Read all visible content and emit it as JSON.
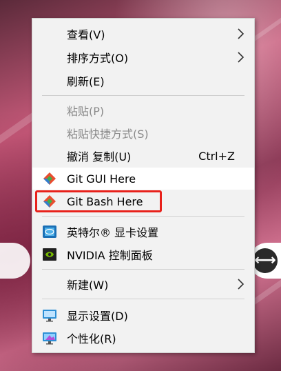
{
  "desktop": {
    "right_icon_glyph": "⟷"
  },
  "menu": {
    "items": [
      {
        "id": "view",
        "label": "查看(V)",
        "has_submenu": true
      },
      {
        "id": "sort",
        "label": "排序方式(O)",
        "has_submenu": true
      },
      {
        "id": "refresh",
        "label": "刷新(E)"
      },
      {
        "id": "paste",
        "label": "粘贴(P)",
        "disabled": true
      },
      {
        "id": "paste-shortcut",
        "label": "粘贴快捷方式(S)",
        "disabled": true
      },
      {
        "id": "undo-copy",
        "label": "撤消 复制(U)",
        "shortcut": "Ctrl+Z"
      },
      {
        "id": "git-gui",
        "label": "Git GUI Here",
        "icon": "git-icon",
        "hovered": true
      },
      {
        "id": "git-bash",
        "label": "Git Bash Here",
        "icon": "git-icon",
        "annotated": true
      },
      {
        "id": "intel-graphics",
        "label": "英特尔® 显卡设置",
        "icon": "intel-graphics-icon"
      },
      {
        "id": "nvidia",
        "label": "NVIDIA 控制面板",
        "icon": "nvidia-icon"
      },
      {
        "id": "new",
        "label": "新建(W)",
        "has_submenu": true
      },
      {
        "id": "display",
        "label": "显示设置(D)",
        "icon": "display-settings-icon"
      },
      {
        "id": "personalize",
        "label": "个性化(R)",
        "icon": "personalize-icon"
      }
    ]
  },
  "colors": {
    "menu_bg": "#f2f2f2",
    "hover_bg": "#ffffff",
    "disabled_text": "#8a8a8a",
    "annotation_red": "#e8211b",
    "git_orange": "#e84e31",
    "git_green": "#3fae49",
    "git_blue": "#2f7fd0"
  }
}
